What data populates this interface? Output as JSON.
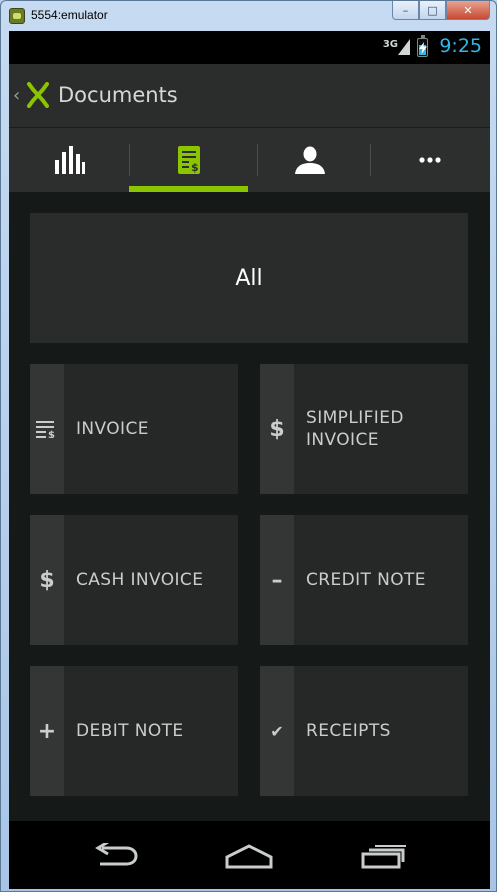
{
  "window": {
    "title": "5554:emulator",
    "minimize": "–",
    "maximize": "□",
    "close": "✕"
  },
  "statusbar": {
    "network": "3G",
    "time": "9:25",
    "battery_level": 0.6,
    "accent": "#33b5e5"
  },
  "actionbar": {
    "back_glyph": "‹",
    "title": "Documents",
    "brand_color": "#8bc500"
  },
  "tabs": [
    {
      "name": "stats",
      "icon": "bar-chart-icon"
    },
    {
      "name": "documents",
      "icon": "invoice-icon",
      "selected": true
    },
    {
      "name": "contacts",
      "icon": "person-icon"
    },
    {
      "name": "more",
      "icon": "more-icon"
    }
  ],
  "tiles": {
    "all": "All",
    "items": [
      {
        "label": "INVOICE",
        "icon": "list-dollar-icon"
      },
      {
        "label": "SIMPLIFIED INVOICE",
        "icon": "dollar-icon"
      },
      {
        "label": "CASH INVOICE",
        "icon": "dollar-icon"
      },
      {
        "label": "CREDIT NOTE",
        "icon": "minus-icon"
      },
      {
        "label": "DEBIT NOTE",
        "icon": "plus-icon"
      },
      {
        "label": "RECEIPTS",
        "icon": "check-icon"
      }
    ]
  },
  "icons": {
    "dollar": "$",
    "minus": "–",
    "plus": "+",
    "check": "✔"
  }
}
